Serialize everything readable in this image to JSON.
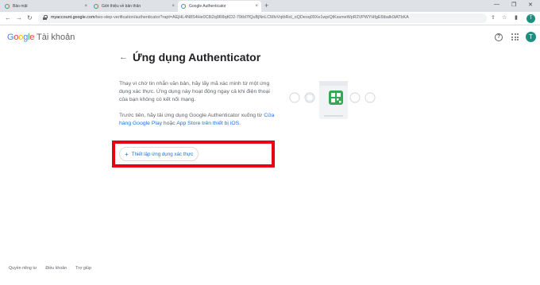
{
  "browser": {
    "tabs": [
      {
        "title": "Bảo mật",
        "close": "×"
      },
      {
        "title": "Giới thiệu về bản thân",
        "close": "×"
      },
      {
        "title": "Google Authenticator",
        "close": "×"
      }
    ],
    "new_tab": "+",
    "window_controls": {
      "minimize": "—",
      "maximize": "❐",
      "close": "✕"
    },
    "nav": {
      "back": "←",
      "forward": "→",
      "reload": "↻"
    },
    "url_host": "myaccount.google.com",
    "url_path": "/two-step-verification/authenticator?rapt=AEjHL4N8S4He0C8i2q9R8qKD2-79tId7fQuBjNnLCMlvVqtbRol_oQDeoq09Xe1wpiQtKssmeWpR2VPWYHfgE6tbalk0iATbKA",
    "profile_initial": "T"
  },
  "header": {
    "logo_letters": [
      "G",
      "o",
      "o",
      "g",
      "l",
      "e"
    ],
    "product": "Tài khoản",
    "help_icon_glyph": "?",
    "avatar_initial": "T"
  },
  "main": {
    "back_glyph": "←",
    "title": "Ứng dụng Authenticator",
    "para1": "Thay vì chờ tin nhắn văn bản, hãy lấy mã xác minh từ một ứng dụng xác thực. Ứng dụng này hoạt động ngay cả khi điện thoại của bạn không có kết nối mạng.",
    "para2_prefix": "Trước tiên, hãy tải ứng dụng Google Authenticator xuống từ ",
    "para2_link1": "Cửa hàng Google Play",
    "para2_middle": " hoặc ",
    "para2_link2": "App Store trên thiết bị iOS",
    "para2_suffix": ".",
    "setup_button": {
      "icon": "+",
      "label": "Thiết lập ứng dụng xác thực"
    }
  },
  "footer": {
    "links": [
      "Quyền riêng tư",
      "Điều khoản",
      "Trợ giúp"
    ]
  },
  "colors": {
    "accent": "#1a73e8",
    "highlight_box": "#e60012",
    "avatar": "#1e8e7e",
    "authenticator_green": "#34a853"
  }
}
